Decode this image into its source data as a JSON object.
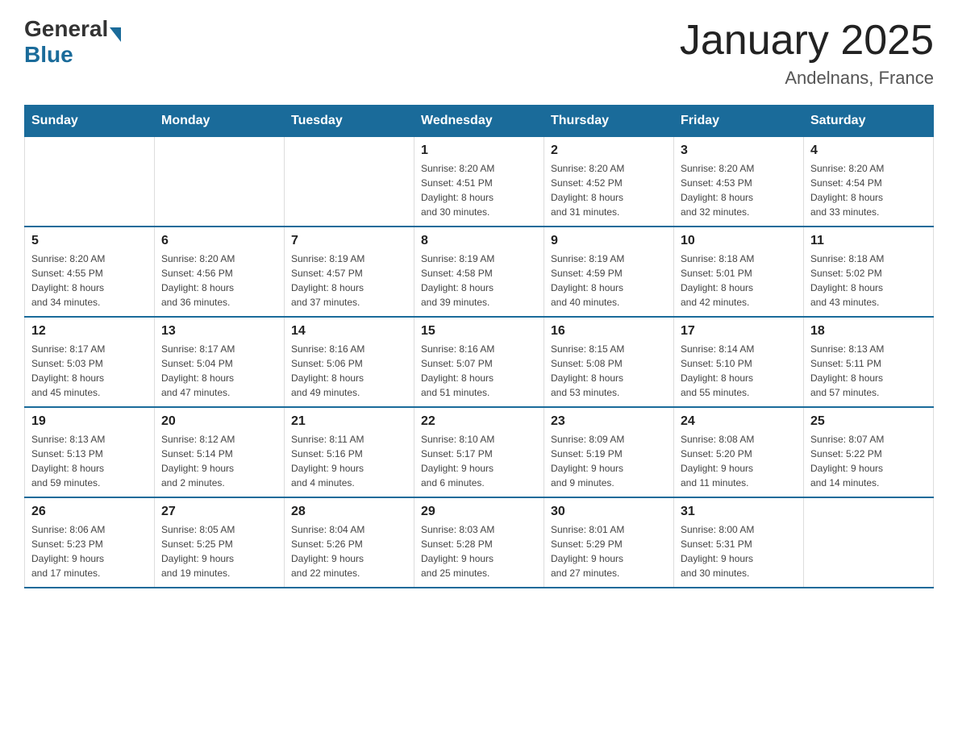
{
  "header": {
    "logo_general": "General",
    "logo_blue": "Blue",
    "title": "January 2025",
    "subtitle": "Andelnans, France"
  },
  "days_of_week": [
    "Sunday",
    "Monday",
    "Tuesday",
    "Wednesday",
    "Thursday",
    "Friday",
    "Saturday"
  ],
  "weeks": [
    [
      {
        "day": "",
        "info": ""
      },
      {
        "day": "",
        "info": ""
      },
      {
        "day": "",
        "info": ""
      },
      {
        "day": "1",
        "info": "Sunrise: 8:20 AM\nSunset: 4:51 PM\nDaylight: 8 hours\nand 30 minutes."
      },
      {
        "day": "2",
        "info": "Sunrise: 8:20 AM\nSunset: 4:52 PM\nDaylight: 8 hours\nand 31 minutes."
      },
      {
        "day": "3",
        "info": "Sunrise: 8:20 AM\nSunset: 4:53 PM\nDaylight: 8 hours\nand 32 minutes."
      },
      {
        "day": "4",
        "info": "Sunrise: 8:20 AM\nSunset: 4:54 PM\nDaylight: 8 hours\nand 33 minutes."
      }
    ],
    [
      {
        "day": "5",
        "info": "Sunrise: 8:20 AM\nSunset: 4:55 PM\nDaylight: 8 hours\nand 34 minutes."
      },
      {
        "day": "6",
        "info": "Sunrise: 8:20 AM\nSunset: 4:56 PM\nDaylight: 8 hours\nand 36 minutes."
      },
      {
        "day": "7",
        "info": "Sunrise: 8:19 AM\nSunset: 4:57 PM\nDaylight: 8 hours\nand 37 minutes."
      },
      {
        "day": "8",
        "info": "Sunrise: 8:19 AM\nSunset: 4:58 PM\nDaylight: 8 hours\nand 39 minutes."
      },
      {
        "day": "9",
        "info": "Sunrise: 8:19 AM\nSunset: 4:59 PM\nDaylight: 8 hours\nand 40 minutes."
      },
      {
        "day": "10",
        "info": "Sunrise: 8:18 AM\nSunset: 5:01 PM\nDaylight: 8 hours\nand 42 minutes."
      },
      {
        "day": "11",
        "info": "Sunrise: 8:18 AM\nSunset: 5:02 PM\nDaylight: 8 hours\nand 43 minutes."
      }
    ],
    [
      {
        "day": "12",
        "info": "Sunrise: 8:17 AM\nSunset: 5:03 PM\nDaylight: 8 hours\nand 45 minutes."
      },
      {
        "day": "13",
        "info": "Sunrise: 8:17 AM\nSunset: 5:04 PM\nDaylight: 8 hours\nand 47 minutes."
      },
      {
        "day": "14",
        "info": "Sunrise: 8:16 AM\nSunset: 5:06 PM\nDaylight: 8 hours\nand 49 minutes."
      },
      {
        "day": "15",
        "info": "Sunrise: 8:16 AM\nSunset: 5:07 PM\nDaylight: 8 hours\nand 51 minutes."
      },
      {
        "day": "16",
        "info": "Sunrise: 8:15 AM\nSunset: 5:08 PM\nDaylight: 8 hours\nand 53 minutes."
      },
      {
        "day": "17",
        "info": "Sunrise: 8:14 AM\nSunset: 5:10 PM\nDaylight: 8 hours\nand 55 minutes."
      },
      {
        "day": "18",
        "info": "Sunrise: 8:13 AM\nSunset: 5:11 PM\nDaylight: 8 hours\nand 57 minutes."
      }
    ],
    [
      {
        "day": "19",
        "info": "Sunrise: 8:13 AM\nSunset: 5:13 PM\nDaylight: 8 hours\nand 59 minutes."
      },
      {
        "day": "20",
        "info": "Sunrise: 8:12 AM\nSunset: 5:14 PM\nDaylight: 9 hours\nand 2 minutes."
      },
      {
        "day": "21",
        "info": "Sunrise: 8:11 AM\nSunset: 5:16 PM\nDaylight: 9 hours\nand 4 minutes."
      },
      {
        "day": "22",
        "info": "Sunrise: 8:10 AM\nSunset: 5:17 PM\nDaylight: 9 hours\nand 6 minutes."
      },
      {
        "day": "23",
        "info": "Sunrise: 8:09 AM\nSunset: 5:19 PM\nDaylight: 9 hours\nand 9 minutes."
      },
      {
        "day": "24",
        "info": "Sunrise: 8:08 AM\nSunset: 5:20 PM\nDaylight: 9 hours\nand 11 minutes."
      },
      {
        "day": "25",
        "info": "Sunrise: 8:07 AM\nSunset: 5:22 PM\nDaylight: 9 hours\nand 14 minutes."
      }
    ],
    [
      {
        "day": "26",
        "info": "Sunrise: 8:06 AM\nSunset: 5:23 PM\nDaylight: 9 hours\nand 17 minutes."
      },
      {
        "day": "27",
        "info": "Sunrise: 8:05 AM\nSunset: 5:25 PM\nDaylight: 9 hours\nand 19 minutes."
      },
      {
        "day": "28",
        "info": "Sunrise: 8:04 AM\nSunset: 5:26 PM\nDaylight: 9 hours\nand 22 minutes."
      },
      {
        "day": "29",
        "info": "Sunrise: 8:03 AM\nSunset: 5:28 PM\nDaylight: 9 hours\nand 25 minutes."
      },
      {
        "day": "30",
        "info": "Sunrise: 8:01 AM\nSunset: 5:29 PM\nDaylight: 9 hours\nand 27 minutes."
      },
      {
        "day": "31",
        "info": "Sunrise: 8:00 AM\nSunset: 5:31 PM\nDaylight: 9 hours\nand 30 minutes."
      },
      {
        "day": "",
        "info": ""
      }
    ]
  ]
}
